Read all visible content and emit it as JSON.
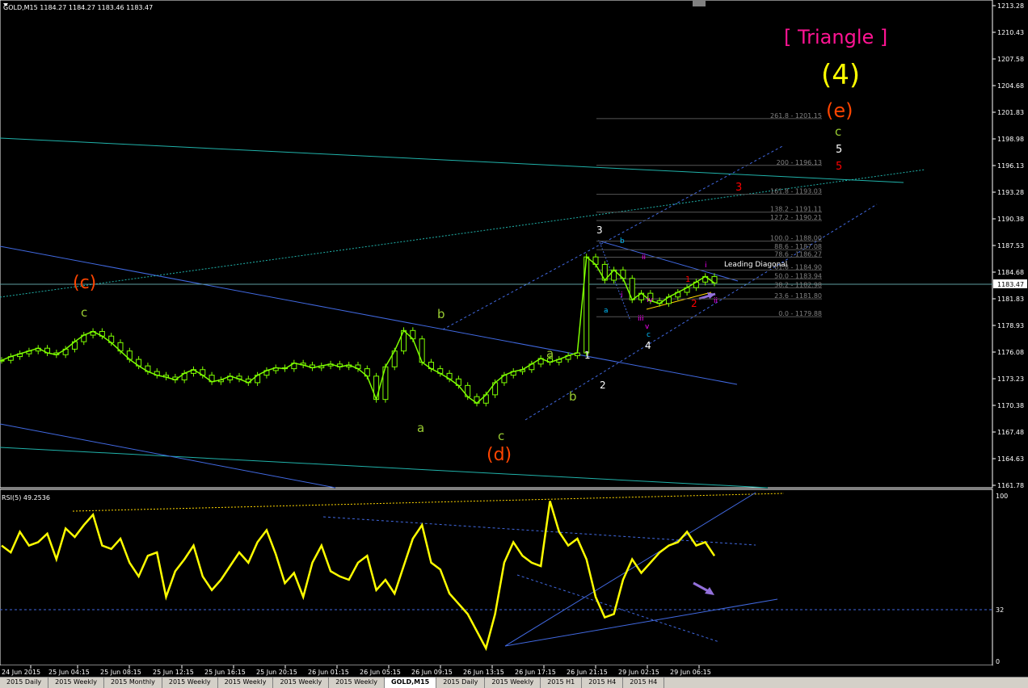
{
  "symbol_header": "GOLD,M15  1184.27 1184.27 1183.46 1183.47",
  "rsi_header": "RSI(5) 49.2536",
  "current_price": "1183.47",
  "price_axis": [
    "1213.28",
    "1210.43",
    "1207.58",
    "1204.68",
    "1201.83",
    "1198.98",
    "1196.13",
    "1193.28",
    "1190.38",
    "1187.53",
    "1184.68",
    "1181.83",
    "1178.93",
    "1176.08",
    "1173.23",
    "1170.38",
    "1167.48",
    "1164.63",
    "1161.78"
  ],
  "rsi_axis": [
    "100",
    "32",
    "0"
  ],
  "time_axis": [
    "24 Jun 2015",
    "25 Jun 04:15",
    "25 Jun 08:15",
    "25 Jun 12:15",
    "25 Jun 16:15",
    "25 Jun 20:15",
    "26 Jun 01:15",
    "26 Jun 05:15",
    "26 Jun 09:15",
    "26 Jun 13:15",
    "26 Jun 17:15",
    "26 Jun 21:15",
    "29 Jun 02:15",
    "29 Jun 06:15"
  ],
  "fib_levels": [
    "261.8 - 1201.15",
    "200 - 1196.13",
    "161.8 - 1193.03",
    "138.2 - 1191.11",
    "127.2 - 1190.21",
    "100.0 - 1188.00",
    "88.6 - 1187.08",
    "78.6 - 1186.27",
    "61.8 - 1184.90",
    "50.0 - 1183.94",
    "38.2 - 1182.98",
    "23.6 - 1181.80",
    "0.0 - 1179.88"
  ],
  "annotations": {
    "triangle": "[ Triangle ]",
    "wave4": "(4)",
    "e": "(e)",
    "c": "(c)",
    "d": "(d)",
    "leading_diagonal": "Leading Diagonal",
    "c_top": "c",
    "five_white": "5",
    "five_red": "5",
    "three_red": "3",
    "three_white": "3",
    "one": "1",
    "two_white": "2",
    "four": "4",
    "two_red": "2",
    "a1": "a",
    "b1": "b",
    "c1": "c",
    "a2": "a",
    "b2": "b",
    "c_wave": "c",
    "a_blue": "a",
    "b_blue": "b",
    "c_blue": "c",
    "i": "i",
    "ii": "ii",
    "iii": "iii",
    "iv": "iv",
    "v": "v",
    "i2": "i",
    "ii2": "ii",
    "y": "y",
    "r1": "1"
  },
  "tabs": [
    "2015 Daily",
    "2015 Weekly",
    "2015 Monthly",
    "2015 Weekly",
    "2015 Weekly",
    "2015 Weekly",
    "2015 Weekly",
    "GOLD,M15",
    "2015 Daily",
    "2015 Weekly",
    "2015 H1",
    "2015 H4",
    "2015 H4"
  ],
  "colors": {
    "bg": "#000000",
    "candle": "#7fff00",
    "rsi": "#ffff00",
    "trend": "#4169e1",
    "teal": "#20b2aa",
    "fib": "#808080"
  },
  "chart_data": {
    "type": "line",
    "title": "GOLD,M15",
    "price_range": [
      1161.78,
      1213.28
    ],
    "rsi_range": [
      0,
      100
    ],
    "rsi_levels": [
      32
    ],
    "price_series": [
      1175.2,
      1175.6,
      1175.9,
      1176.2,
      1176.5,
      1176.0,
      1175.8,
      1176.4,
      1177.2,
      1177.9,
      1178.3,
      1177.8,
      1177.1,
      1176.2,
      1175.3,
      1174.6,
      1174.0,
      1173.6,
      1173.4,
      1173.1,
      1173.8,
      1174.2,
      1173.6,
      1172.9,
      1173.1,
      1173.5,
      1173.2,
      1172.8,
      1173.6,
      1174.1,
      1174.4,
      1174.3,
      1174.9,
      1174.7,
      1174.4,
      1174.6,
      1174.8,
      1174.5,
      1174.7,
      1174.3,
      1173.5,
      1171.0,
      1174.5,
      1176.2,
      1178.4,
      1177.5,
      1175.0,
      1174.3,
      1173.8,
      1173.2,
      1172.5,
      1171.3,
      1170.6,
      1171.5,
      1172.8,
      1173.6,
      1174.0,
      1174.2,
      1174.8,
      1175.4,
      1175.0,
      1175.3,
      1175.7,
      1176.0,
      1186.3,
      1185.5,
      1183.8,
      1184.9,
      1184.0,
      1181.7,
      1182.4,
      1181.6,
      1181.3,
      1182.0,
      1182.5,
      1183.0,
      1183.6,
      1184.2,
      1183.5
    ],
    "rsi_series": [
      70,
      66,
      78,
      70,
      72,
      77,
      62,
      80,
      75,
      82,
      88,
      70,
      68,
      74,
      60,
      52,
      64,
      66,
      40,
      55,
      62,
      70,
      52,
      44,
      50,
      58,
      66,
      60,
      72,
      79,
      65,
      48,
      54,
      40,
      60,
      70,
      55,
      52,
      50,
      60,
      64,
      44,
      50,
      42,
      58,
      74,
      82,
      60,
      56,
      42,
      36,
      30,
      20,
      10,
      30,
      60,
      72,
      64,
      60,
      58,
      96,
      78,
      70,
      74,
      62,
      40,
      28,
      30,
      50,
      62,
      54,
      60,
      66,
      70,
      72,
      78,
      70,
      72,
      64
    ],
    "rsi_current": 49.2536
  }
}
